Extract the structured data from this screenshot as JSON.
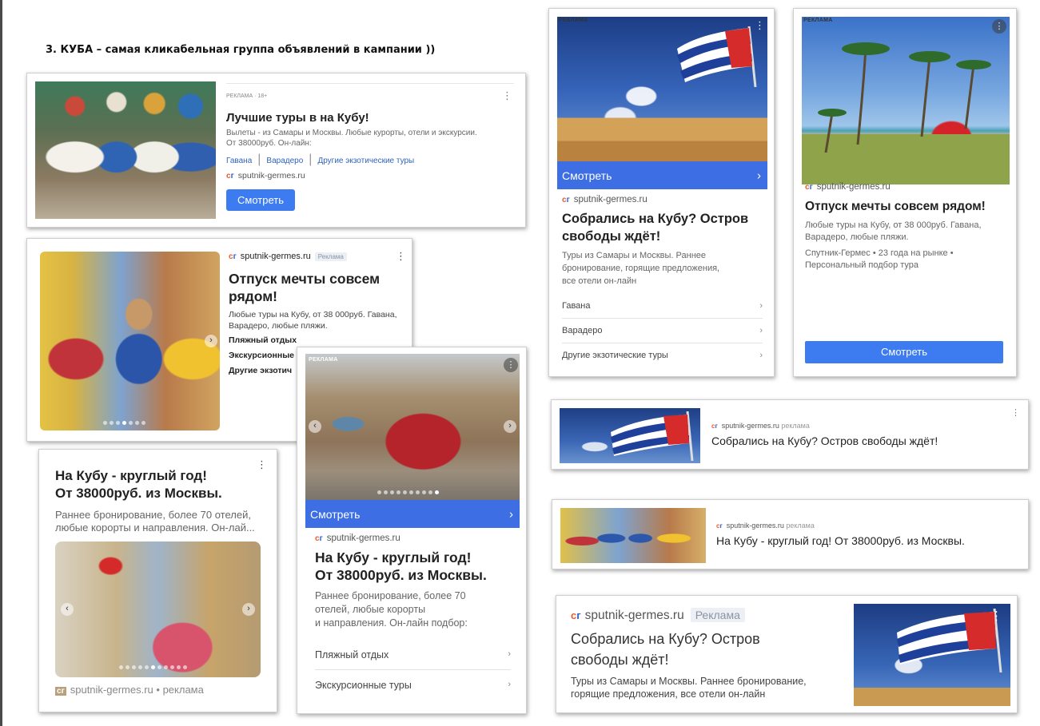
{
  "header": {
    "text": "3. КУБА – самая кликабельная группа объявлений в кампании ))"
  },
  "ad1": {
    "tag": "РЕКЛАМА · 18+",
    "title": "Лучшие туры в на Кубу!",
    "desc_1": "Вылеты - из Самары и Москвы. Любые курорты, отели и экскурсии.",
    "desc_2": "От 38000руб. Он-лайн:",
    "links": [
      "Гавана",
      "Варадеро",
      "Другие экзотические туры"
    ],
    "site": "sputnik-germes.ru",
    "button": "Смотреть"
  },
  "ad2": {
    "site": "sputnik-germes.ru",
    "badge": "Реклама",
    "title_1": "Отпуск мечты совсем",
    "title_2": "рядом!",
    "desc_1": "Любые туры на Кубу, от 38 000руб. Гавана,",
    "desc_2": "Варадеро, любые пляжи.",
    "items": [
      "Пляжный отдых",
      "Экскурсионные т",
      "Другие экзотич"
    ]
  },
  "ad3": {
    "title_1": "На Кубу - круглый год!",
    "title_2": "От 38000руб. из Москвы.",
    "desc_1": "Раннее бронирование, более 70 отелей,",
    "desc_2": "любые корорты и направления. Он-лай...",
    "site": "sputnik-germes.ru",
    "suffix": "• реклама"
  },
  "ad4": {
    "tag": "РЕКЛАМА",
    "button": "Смотреть",
    "site": "sputnik-germes.ru",
    "title_1": "На Кубу - круглый год!",
    "title_2": "От 38000руб. из Москвы.",
    "desc_1": "Раннее бронирование, более 70",
    "desc_2": "отелей, любые корорты",
    "desc_3": "и направления. Он-лайн подбор:",
    "items": [
      "Пляжный отдых",
      "Экскурсионные туры"
    ]
  },
  "ad5": {
    "tag": "РЕКЛАМА",
    "button": "Смотреть",
    "site": "sputnik-germes.ru",
    "title_1": "Собрались на Кубу? Остров",
    "title_2": "свободы ждёт!",
    "desc_1": "Туры из Самары и Москвы. Раннее",
    "desc_2": "бронирование, горящие предложения,",
    "desc_3": "все отели он-лайн",
    "items": [
      "Гавана",
      "Варадеро",
      "Другие экзотические туры"
    ]
  },
  "ad6": {
    "tag": "РЕКЛАМА",
    "site": "sputnik-germes.ru",
    "title": "Отпуск мечты совсем рядом!",
    "desc_1": "Любые туры на Кубу, от 38 000руб. Гавана,",
    "desc_2": "Варадеро, любые пляжи.",
    "note_1": "Спутник-Гермес • 23 года на рынке •",
    "note_2": "Персональный подбор тура",
    "button": "Смотреть"
  },
  "ad7": {
    "site": "sputnik-germes.ru",
    "suffix": "реклама",
    "title": "Собрались на Кубу? Остров свободы ждёт!"
  },
  "ad8": {
    "site": "sputnik-germes.ru",
    "suffix": "реклама",
    "title": "На Кубу - круглый год! От 38000руб. из Москвы."
  },
  "ad9": {
    "site": "sputnik-germes.ru",
    "badge": "Реклама",
    "title_1": "Собрались на Кубу? Остров",
    "title_2": "свободы ждёт!",
    "desc_1": "Туры из Самары и Москвы. Раннее бронирование,",
    "desc_2": "горящие предложения, все отели он-лайн"
  },
  "icons": {
    "menu": "⋮",
    "chevron": "›",
    "logo": "сг"
  },
  "colors": {
    "accent": "#3d7cf0",
    "bar": "#3d6ee3",
    "logo": "#e85a2c"
  }
}
